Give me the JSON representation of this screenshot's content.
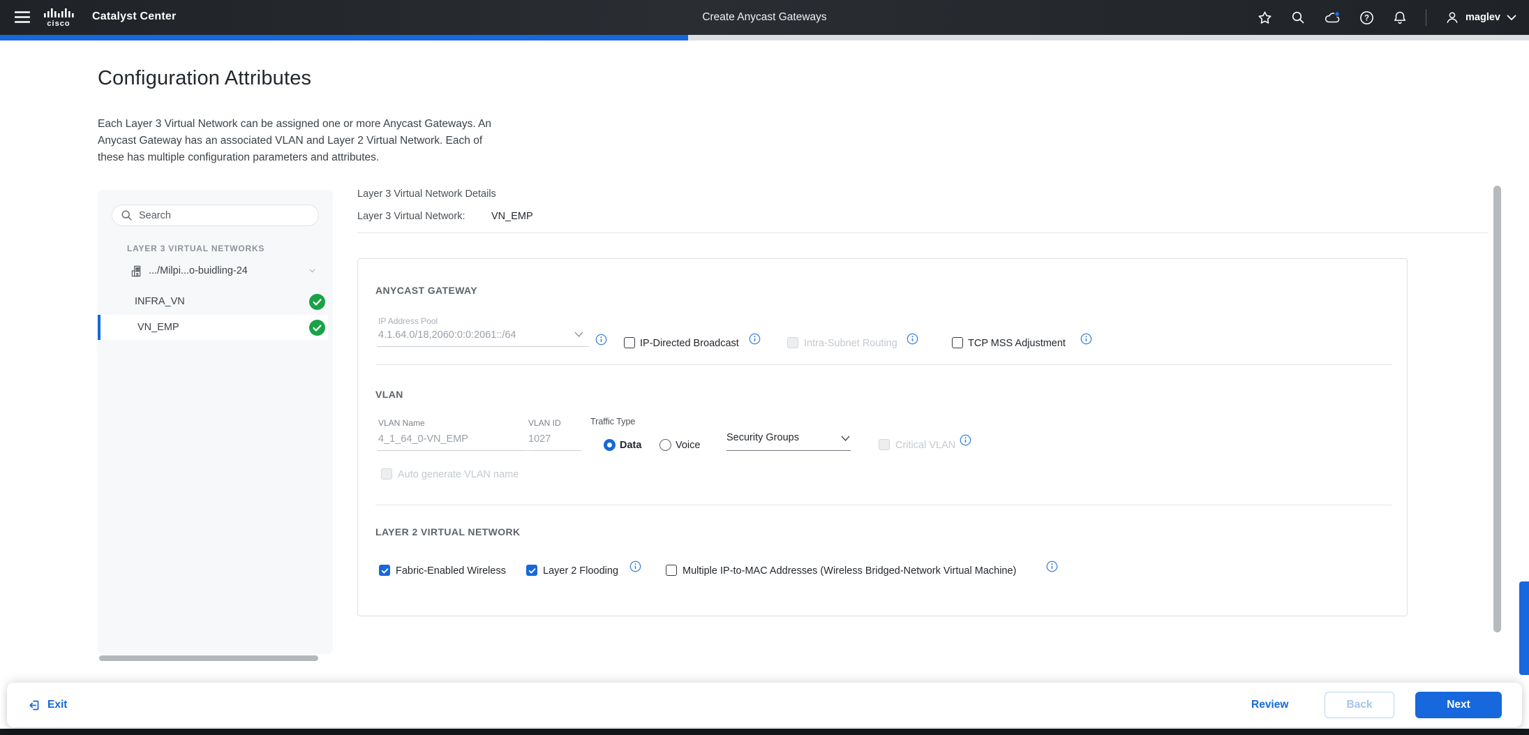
{
  "colors": {
    "accent": "#1668dc",
    "green": "#17a346",
    "header_bg": "#23272b",
    "track": "#dcdee1"
  },
  "progress": {
    "percent": 45
  },
  "header": {
    "brand": "Catalyst Center",
    "title": "Create Anycast Gateways",
    "username": "maglev",
    "icons": [
      "menu-icon",
      "cisco-logo",
      "favorites-star-icon",
      "search-icon",
      "cloud-status-icon",
      "help-icon",
      "notifications-bell-icon",
      "user-icon",
      "chevron-down-icon"
    ]
  },
  "page": {
    "heading": "Configuration Attributes",
    "description_lines": [
      "Each Layer 3 Virtual Network can be assigned one or more Anycast Gateways. An",
      "Anycast Gateway has an associated VLAN and Layer 2 Virtual Network. Each of",
      "these has multiple configuration parameters and attributes."
    ]
  },
  "sidebar": {
    "search_placeholder": "Search",
    "section_label": "LAYER 3 VIRTUAL NETWORKS",
    "site_label": ".../Milpi...o-buidling-24",
    "items": [
      {
        "label": "INFRA_VN",
        "status": "complete",
        "selected": false
      },
      {
        "label": "VN_EMP",
        "status": "complete",
        "selected": true
      }
    ]
  },
  "details": {
    "title": "Layer 3 Virtual Network Details",
    "network_label": "Layer 3 Virtual Network:",
    "network_value": "VN_EMP",
    "anycast": {
      "section_title": "ANYCAST GATEWAY",
      "pool_label": "IP Address Pool",
      "pool_value": "4.1.64.0/18,2060:0:0:2061::/64",
      "checkboxes": [
        {
          "label": "IP-Directed Broadcast",
          "checked": false,
          "disabled": false
        },
        {
          "label": "Intra-Subnet Routing",
          "checked": false,
          "disabled": true
        },
        {
          "label": "TCP MSS Adjustment",
          "checked": false,
          "disabled": false
        }
      ]
    },
    "vlan": {
      "section_title": "VLAN",
      "name_label": "VLAN Name",
      "name_value": "4_1_64_0-VN_EMP",
      "id_label": "VLAN ID",
      "id_value": "1027",
      "traffic_type_label": "Traffic Type",
      "traffic_options": [
        {
          "label": "Data",
          "selected": true
        },
        {
          "label": "Voice",
          "selected": false
        }
      ],
      "security_groups_value": "Security Groups",
      "critical_vlan_label": "Critical VLAN",
      "auto_generate_label": "Auto generate VLAN name"
    },
    "layer2": {
      "section_title": "LAYER 2 VIRTUAL NETWORK",
      "checkboxes": [
        {
          "label": "Fabric-Enabled Wireless",
          "checked": true
        },
        {
          "label": "Layer 2 Flooding",
          "checked": true
        },
        {
          "label": "Multiple IP-to-MAC Addresses (Wireless Bridged-Network Virtual Machine)",
          "checked": false
        }
      ]
    }
  },
  "footer": {
    "exit_label": "Exit",
    "review_label": "Review",
    "back_label": "Back",
    "next_label": "Next"
  }
}
